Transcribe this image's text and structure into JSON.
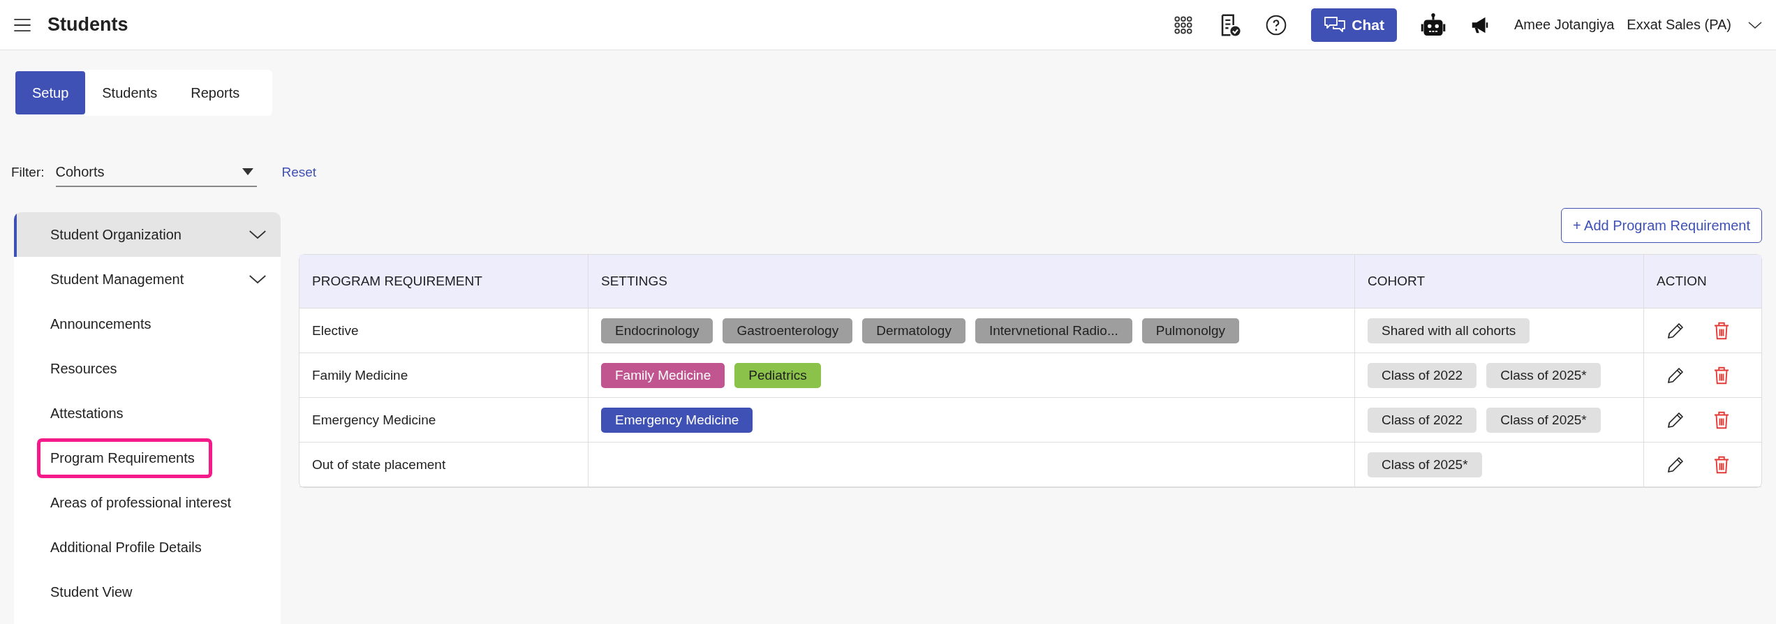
{
  "header": {
    "title": "Students",
    "chat_button": "Chat",
    "user_name": "Amee Jotangiya",
    "organization": "Exxat Sales (PA)"
  },
  "tabs": [
    {
      "label": "Setup",
      "selected": true
    },
    {
      "label": "Students",
      "selected": false
    },
    {
      "label": "Reports",
      "selected": false
    }
  ],
  "filter": {
    "label": "Filter:",
    "value": "Cohorts",
    "reset": "Reset"
  },
  "sidebar": {
    "items": [
      {
        "label": "Student Organization",
        "selected": true,
        "expandable": true,
        "highlighted": false
      },
      {
        "label": "Student Management",
        "selected": false,
        "expandable": true,
        "highlighted": false
      },
      {
        "label": "Announcements",
        "selected": false,
        "expandable": false,
        "highlighted": false
      },
      {
        "label": "Resources",
        "selected": false,
        "expandable": false,
        "highlighted": false
      },
      {
        "label": "Attestations",
        "selected": false,
        "expandable": false,
        "highlighted": false
      },
      {
        "label": "Program Requirements",
        "selected": false,
        "expandable": false,
        "highlighted": true
      },
      {
        "label": "Areas of professional interest",
        "selected": false,
        "expandable": false,
        "highlighted": false
      },
      {
        "label": "Additional Profile Details",
        "selected": false,
        "expandable": false,
        "highlighted": false
      },
      {
        "label": "Student View",
        "selected": false,
        "expandable": false,
        "highlighted": false
      }
    ]
  },
  "add_button": "+ Add Program Requirement",
  "table": {
    "columns": [
      "PROGRAM REQUIREMENT",
      "SETTINGS",
      "COHORT",
      "ACTION"
    ],
    "rows": [
      {
        "requirement": "Elective",
        "settings": [
          {
            "label": "Endocrinology",
            "color": "#9e9e9e"
          },
          {
            "label": "Gastroenterology",
            "color": "#9e9e9e"
          },
          {
            "label": "Dermatology",
            "color": "#9e9e9e"
          },
          {
            "label": "Intervnetional Radio...",
            "color": "#9e9e9e"
          },
          {
            "label": "Pulmonolgy",
            "color": "#9e9e9e"
          }
        ],
        "cohorts": [
          "Shared with all cohorts"
        ]
      },
      {
        "requirement": "Family Medicine",
        "settings": [
          {
            "label": "Family Medicine",
            "color": "#c0558f"
          },
          {
            "label": "Pediatrics",
            "color": "#8bc34a"
          }
        ],
        "cohorts": [
          "Class of 2022",
          "Class of 2025*"
        ]
      },
      {
        "requirement": "Emergency Medicine",
        "settings": [
          {
            "label": "Emergency Medicine",
            "color": "#3f51b5"
          }
        ],
        "cohorts": [
          "Class of 2022",
          "Class of 2025*"
        ]
      },
      {
        "requirement": "Out of state placement",
        "settings": [],
        "cohorts": [
          "Class of 2025*"
        ]
      }
    ]
  }
}
